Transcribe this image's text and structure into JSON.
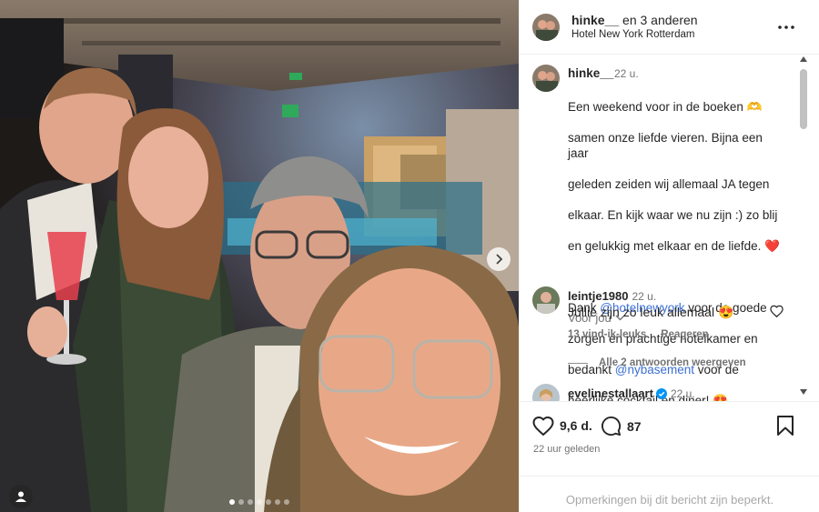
{
  "post": {
    "header": {
      "username": "hinke__",
      "coauthors": "en 3 anderen",
      "location": "Hotel New York Rotterdam",
      "more_icon": "more-horizontal-icon"
    },
    "caption": {
      "username": "hinke__",
      "time": "22 u.",
      "lines": [
        "Een weekend voor in de boeken 🫶",
        "samen onze liefde vieren. Bijna een jaar",
        "geleden zeiden wij allemaal JA tegen",
        "elkaar. En kijk waar we nu zijn :) zo blij",
        "en gelukkig met elkaar en de liefde. ❤️",
        "",
        "Dank @hotelnewyork voor de goede",
        "zorgen en prachtige hotelkamer en",
        "bedankt @nybasement voor de",
        "heerlijke cocktail en diner! 😍"
      ],
      "line7_prefix": "Dank ",
      "mention1": "@hotelnewyork",
      "line7_suffix": " voor de goede",
      "line9_prefix": "bedankt ",
      "mention2": "@nybasement",
      "line9_suffix": " voor de",
      "translate": "Voor jou"
    },
    "comments": [
      {
        "username": "leintje1980",
        "time": "22 u.",
        "text": "Jullie zijn zo leuk allemaal 😍",
        "likes": "13 vind-ik-leuks",
        "reply": "Reageren",
        "view_replies": "Alle 2 antwoorden weergeven"
      },
      {
        "username": "evelinestallaart",
        "verified": true,
        "time": "22 u."
      }
    ],
    "actions": {
      "likes": "9,6 d.",
      "comments": "87",
      "posted": "22 uur geleden"
    },
    "footer": "Opmerkingen bij dit bericht zijn beperkt.",
    "carousel": {
      "count": 7,
      "active": 0
    }
  },
  "colors": {
    "accent": "#0095f6",
    "mention": "#3b6fd6",
    "muted": "#737373"
  }
}
